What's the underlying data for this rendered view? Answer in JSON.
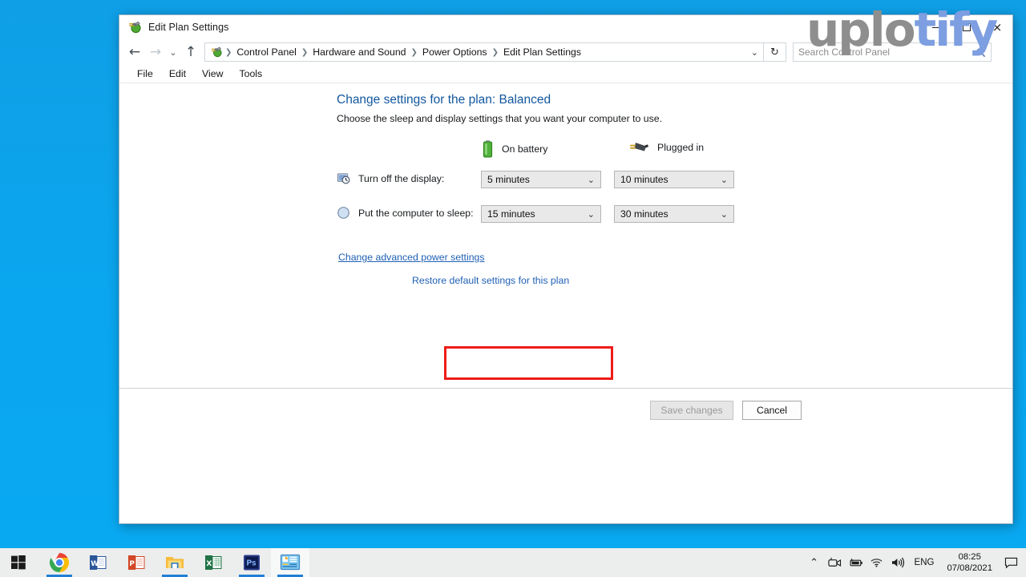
{
  "desktop": {
    "background_color": "#0fa3e8"
  },
  "watermark": {
    "part1": "uplo",
    "part2": "tify",
    "color1": "#8e8e8e",
    "color2": "#7d9ee0"
  },
  "window": {
    "title": "Edit Plan Settings",
    "title_icon": "power-plan-icon",
    "controls": {
      "minimize": "minimize-icon",
      "maximize": "maximize-icon",
      "close": "×"
    },
    "nav": {
      "back": "←",
      "forward": "→",
      "recent": "⌄",
      "up": "↑",
      "refresh": "↻",
      "dropdown": "⌄"
    },
    "breadcrumb": {
      "icon": "power-plan-icon",
      "items": [
        "Control Panel",
        "Hardware and Sound",
        "Power Options",
        "Edit Plan Settings"
      ],
      "separator": "❯"
    },
    "search": {
      "placeholder": "Search Control Panel",
      "value": "",
      "icon": "search-icon"
    },
    "menubar": [
      "File",
      "Edit",
      "View",
      "Tools"
    ]
  },
  "main": {
    "heading": "Change settings for the plan: Balanced",
    "subheading": "Choose the sleep and display settings that you want your computer to use.",
    "columns": [
      {
        "label": "On battery",
        "icon": "battery-icon"
      },
      {
        "label": "Plugged in",
        "icon": "power-plug-icon"
      }
    ],
    "settings": [
      {
        "label": "Turn off the display:",
        "icon": "display-clock-icon",
        "on_battery": "5 minutes",
        "plugged_in": "10 minutes"
      },
      {
        "label": "Put the computer to sleep:",
        "icon": "sleep-moon-icon",
        "on_battery": "15 minutes",
        "plugged_in": "30 minutes"
      }
    ],
    "links": {
      "advanced": "Change advanced power settings",
      "restore": "Restore default settings for this plan"
    },
    "highlight_color": "#ee1c19",
    "buttons": {
      "save": {
        "label": "Save changes",
        "enabled": false
      },
      "cancel": {
        "label": "Cancel",
        "enabled": true
      }
    }
  },
  "taskbar": {
    "start": "windows-start-icon",
    "apps": [
      {
        "name": "chrome-icon",
        "active": true
      },
      {
        "name": "word-icon",
        "active": false
      },
      {
        "name": "powerpoint-icon",
        "active": false
      },
      {
        "name": "file-explorer-icon",
        "active": true
      },
      {
        "name": "excel-icon",
        "active": false
      },
      {
        "name": "photoshop-icon",
        "active": true
      },
      {
        "name": "control-panel-icon",
        "active": true
      }
    ],
    "tray": {
      "chevron": "⌃",
      "camera": "camera-icon",
      "battery": "battery-charging-icon",
      "wifi": "wifi-icon",
      "volume": "volume-icon",
      "language": "ENG",
      "time": "08:25",
      "date": "07/08/2021",
      "notifications": "notification-icon"
    }
  }
}
